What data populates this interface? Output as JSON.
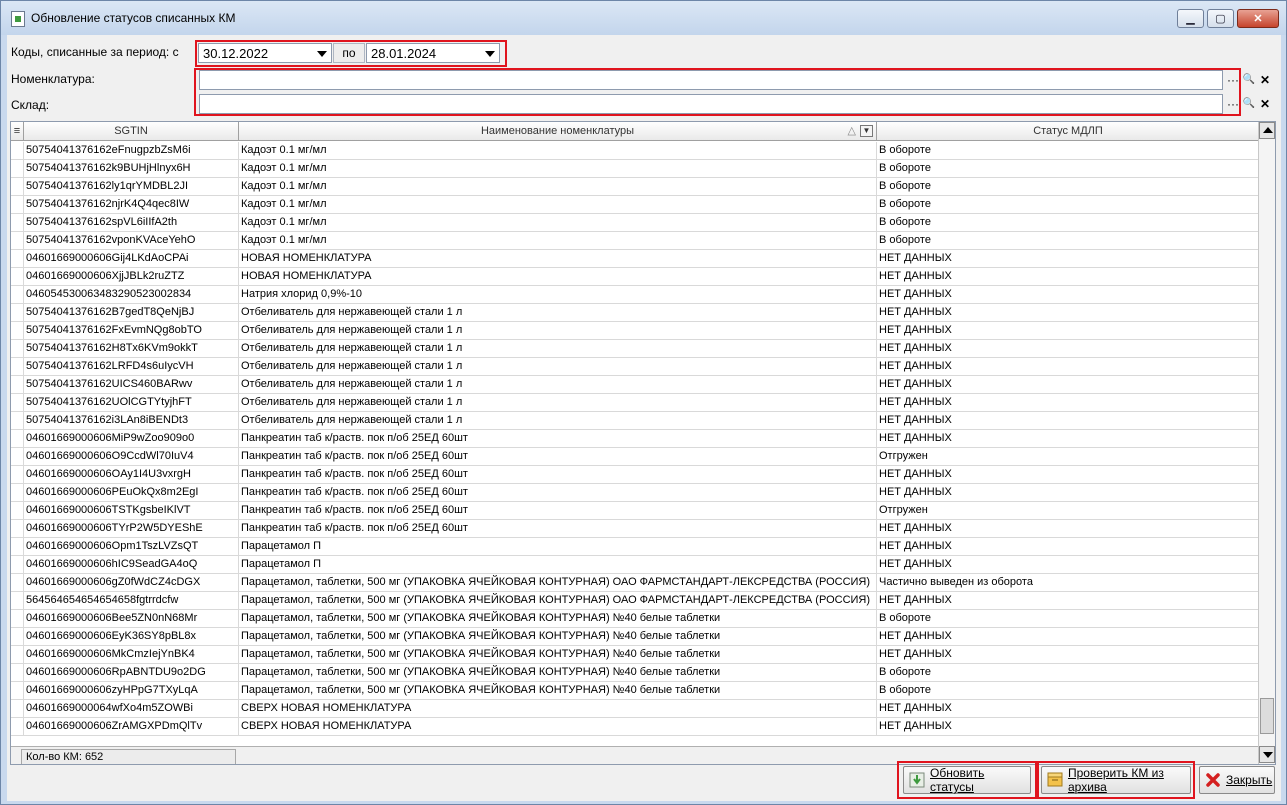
{
  "window": {
    "title": "Обновление статусов списанных КМ",
    "controls": {
      "minimize": "▁",
      "maximize": "▢",
      "close": "✕"
    }
  },
  "filters": {
    "period_label": "Коды, списанные за период: с",
    "date_from": "30.12.2022",
    "po_label": "по",
    "date_to": "28.01.2024",
    "nomenclature_label": "Номенклатура:",
    "nomenclature_value": "",
    "warehouse_label": "Склад:",
    "warehouse_value": ""
  },
  "field_icons": {
    "select": "···",
    "search": "🔍",
    "clear": "✕"
  },
  "table": {
    "columns": [
      "SGTIN",
      "Наименование номенклатуры",
      "Статус МДЛП"
    ],
    "rows": [
      [
        "50754041376162eFnugpzbZsM6i",
        "Кадоэт 0.1 мг/мл",
        "В обороте"
      ],
      [
        "50754041376162k9BUHjHlnyx6H",
        "Кадоэт 0.1 мг/мл",
        "В обороте"
      ],
      [
        "50754041376162ly1qrYMDBL2JI",
        "Кадоэт 0.1 мг/мл",
        "В обороте"
      ],
      [
        "50754041376162njrK4Q4qec8IW",
        "Кадоэт 0.1 мг/мл",
        "В обороте"
      ],
      [
        "50754041376162spVL6iIIfA2th",
        "Кадоэт 0.1 мг/мл",
        "В обороте"
      ],
      [
        "50754041376162vponKVAceYehO",
        "Кадоэт 0.1 мг/мл",
        "В обороте"
      ],
      [
        "04601669000606Gij4LKdAoCPAi",
        "НОВАЯ НОМЕНКЛАТУРА",
        "НЕТ ДАННЫХ"
      ],
      [
        "04601669000606XjjJBLk2ruZTZ",
        "НОВАЯ НОМЕНКЛАТУРА",
        "НЕТ ДАННЫХ"
      ],
      [
        "046054530063483290523002834",
        "Натрия хлорид 0,9%-10",
        "НЕТ ДАННЫХ"
      ],
      [
        "50754041376162B7gedT8QeNjBJ",
        "Отбеливатель для нержавеющей стали 1 л",
        "НЕТ ДАННЫХ"
      ],
      [
        "50754041376162FxEvmNQg8obTO",
        "Отбеливатель для нержавеющей стали 1 л",
        "НЕТ ДАННЫХ"
      ],
      [
        "50754041376162H8Tx6KVm9okkT",
        "Отбеливатель для нержавеющей стали 1 л",
        "НЕТ ДАННЫХ"
      ],
      [
        "50754041376162LRFD4s6uIycVH",
        "Отбеливатель для нержавеющей стали 1 л",
        "НЕТ ДАННЫХ"
      ],
      [
        "50754041376162UICS460BARwv",
        "Отбеливатель для нержавеющей стали 1 л",
        "НЕТ ДАННЫХ"
      ],
      [
        "50754041376162UOlCGTYtyjhFT",
        "Отбеливатель для нержавеющей стали 1 л",
        "НЕТ ДАННЫХ"
      ],
      [
        "50754041376162i3LAn8iBENDt3",
        "Отбеливатель для нержавеющей стали 1 л",
        "НЕТ ДАННЫХ"
      ],
      [
        "04601669000606MiP9wZoo909o0",
        "Панкреатин таб к/раств. пок п/об 25ЕД 60шт",
        "НЕТ ДАННЫХ"
      ],
      [
        "04601669000606O9CcdWl70IuV4",
        "Панкреатин таб к/раств. пок п/об 25ЕД 60шт",
        "Отгружен"
      ],
      [
        "04601669000606OAy1I4U3vxrgH",
        "Панкреатин таб к/раств. пок п/об 25ЕД 60шт",
        "НЕТ ДАННЫХ"
      ],
      [
        "04601669000606PEuOkQx8m2EgI",
        "Панкреатин таб к/раств. пок п/об 25ЕД 60шт",
        "НЕТ ДАННЫХ"
      ],
      [
        "04601669000606TSTKgsbeIKlVT",
        "Панкреатин таб к/раств. пок п/об 25ЕД 60шт",
        "Отгружен"
      ],
      [
        "04601669000606TYrP2W5DYEShE",
        "Панкреатин таб к/раств. пок п/об 25ЕД 60шт",
        "НЕТ ДАННЫХ"
      ],
      [
        "04601669000606Opm1TszLVZsQT",
        "Парацетамол П",
        "НЕТ ДАННЫХ"
      ],
      [
        "04601669000606hIC9SeadGA4oQ",
        "Парацетамол П",
        "НЕТ ДАННЫХ"
      ],
      [
        "04601669000606gZ0fWdCZ4cDGX",
        "Парацетамол, таблетки, 500 мг (УПАКОВКА ЯЧЕЙКОВАЯ КОНТУРНАЯ) ОАО ФАРМСТАНДАРТ-ЛЕКСРЕДСТВА (РОССИЯ)",
        "Частично выведен из оборота"
      ],
      [
        "564564654654654658fgtrrdcfw",
        "Парацетамол, таблетки, 500 мг (УПАКОВКА ЯЧЕЙКОВАЯ КОНТУРНАЯ) ОАО ФАРМСТАНДАРТ-ЛЕКСРЕДСТВА (РОССИЯ)",
        "НЕТ ДАННЫХ"
      ],
      [
        "04601669000606Bee5ZN0nN68Mr",
        "Парацетамол, таблетки, 500 мг (УПАКОВКА ЯЧЕЙКОВАЯ КОНТУРНАЯ) №40 белые таблетки",
        "В обороте"
      ],
      [
        "04601669000606EyK36SY8pBL8x",
        "Парацетамол, таблетки, 500 мг (УПАКОВКА ЯЧЕЙКОВАЯ КОНТУРНАЯ) №40 белые таблетки",
        "НЕТ ДАННЫХ"
      ],
      [
        "04601669000606MkCmzIejYnBK4",
        "Парацетамол, таблетки, 500 мг (УПАКОВКА ЯЧЕЙКОВАЯ КОНТУРНАЯ) №40 белые таблетки",
        "НЕТ ДАННЫХ"
      ],
      [
        "04601669000606RpABNTDU9o2DG",
        "Парацетамол, таблетки, 500 мг (УПАКОВКА ЯЧЕЙКОВАЯ КОНТУРНАЯ) №40 белые таблетки",
        "В обороте"
      ],
      [
        "04601669000606zyHPpG7TXyLqA",
        "Парацетамол, таблетки, 500 мг (УПАКОВКА ЯЧЕЙКОВАЯ КОНТУРНАЯ) №40 белые таблетки",
        "В обороте"
      ],
      [
        "04601669000064wfXo4m5ZOWBi",
        "СВЕРХ НОВАЯ НОМЕНКЛАТУРА",
        "НЕТ ДАННЫХ"
      ],
      [
        "04601669000606ZrAMGXPDmQlTv",
        "СВЕРХ НОВАЯ НОМЕНКЛАТУРА",
        "НЕТ ДАННЫХ"
      ]
    ],
    "count_label": "Кол-во КМ: 652"
  },
  "buttons": {
    "update_statuses": "Обновить статусы",
    "check_archive": "Проверить КМ из архива",
    "close": "Закрыть"
  },
  "colors": {
    "highlight_border": "#e0141e",
    "window_frame": "#c9d9ee"
  }
}
